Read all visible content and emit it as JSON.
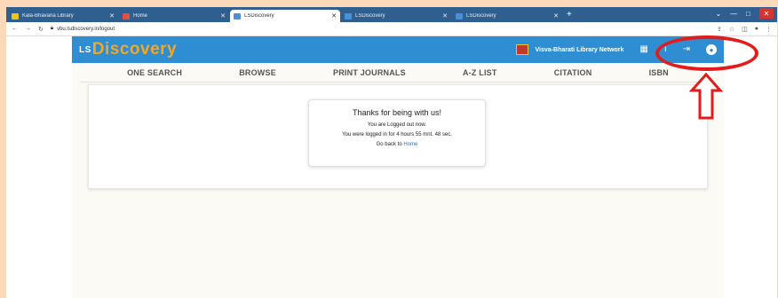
{
  "tabs": [
    {
      "label": "Kala-Bhavana Library",
      "favicon_color": "#f1c40f",
      "active": false
    },
    {
      "label": "Home",
      "favicon_color": "#e74c3c",
      "active": false
    },
    {
      "label": "LSDiscovery",
      "favicon_color": "#4a90d9",
      "active": true
    },
    {
      "label": "LSDiscovery",
      "favicon_color": "#4a90d9",
      "active": false
    },
    {
      "label": "LSDiscovery",
      "favicon_color": "#4a90d9",
      "active": false
    }
  ],
  "address": {
    "url": "vbu.lsdiscovery.in/logout"
  },
  "site": {
    "logo_prefix": "LS",
    "logo_text": "Discovery",
    "network_name": "Visva-Bharati Library Network"
  },
  "menu": [
    "ONE SEARCH",
    "BROWSE",
    "PRINT JOURNALS",
    "A-Z LIST",
    "CITATION",
    "ISBN"
  ],
  "logout_card": {
    "title": "Thanks for being with us!",
    "line1": "You are Logged out now.",
    "line2": "You were logged in for  4 hours 55 mnt. 48 sec.",
    "back_prefix": "Go back to ",
    "back_link": "Home"
  },
  "colors": {
    "navbar": "#2f8ed1",
    "logo": "#f5a623",
    "highlight": "#e41b1b",
    "background": "#fcd9b8"
  }
}
